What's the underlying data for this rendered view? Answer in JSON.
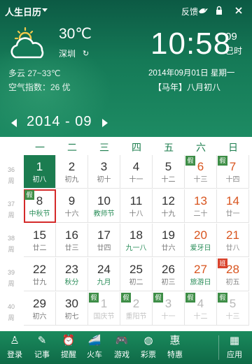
{
  "app": {
    "title": "人生日历",
    "feedback": "反馈"
  },
  "weather": {
    "temperature": "30℃",
    "city": "深圳",
    "refresh_icon": "↻",
    "desc": "多云  27~33℃",
    "aqi": "空气指数：26 优"
  },
  "clock": {
    "time": "10:58",
    "seconds": "09",
    "ampm": "巳时"
  },
  "date": {
    "gregorian": "2014年09月01日  星期一",
    "lunar": "【马年】八月初八"
  },
  "nav": {
    "month": "2014 - 09"
  },
  "weekdays": [
    "一",
    "二",
    "三",
    "四",
    "五",
    "六",
    "日"
  ],
  "weeks": [
    {
      "num": "36",
      "label": "周",
      "days": [
        {
          "d": "1",
          "l": "初八",
          "state": "today"
        },
        {
          "d": "2",
          "l": "初九"
        },
        {
          "d": "3",
          "l": "初十"
        },
        {
          "d": "4",
          "l": "十一"
        },
        {
          "d": "5",
          "l": "十二"
        },
        {
          "d": "6",
          "l": "十三",
          "weekend": true,
          "badge": "假"
        },
        {
          "d": "7",
          "l": "十四",
          "weekend": true,
          "badge": "假"
        }
      ]
    },
    {
      "num": "37",
      "label": "周",
      "days": [
        {
          "d": "8",
          "l": "中秋节",
          "fest": true,
          "badge": "假",
          "state": "selected"
        },
        {
          "d": "9",
          "l": "十六"
        },
        {
          "d": "10",
          "l": "教师节",
          "fest": true
        },
        {
          "d": "11",
          "l": "十八"
        },
        {
          "d": "12",
          "l": "十九"
        },
        {
          "d": "13",
          "l": "二十",
          "weekend": true
        },
        {
          "d": "14",
          "l": "廿一",
          "weekend": true
        }
      ]
    },
    {
      "num": "38",
      "label": "周",
      "days": [
        {
          "d": "15",
          "l": "廿二"
        },
        {
          "d": "16",
          "l": "廿三"
        },
        {
          "d": "17",
          "l": "廿四"
        },
        {
          "d": "18",
          "l": "九一八",
          "fest": true
        },
        {
          "d": "19",
          "l": "廿六"
        },
        {
          "d": "20",
          "l": "爱牙日",
          "weekend": true,
          "fest": true
        },
        {
          "d": "21",
          "l": "廿八",
          "weekend": true
        }
      ]
    },
    {
      "num": "39",
      "label": "周",
      "days": [
        {
          "d": "22",
          "l": "廿九"
        },
        {
          "d": "23",
          "l": "秋分",
          "fest": true
        },
        {
          "d": "24",
          "l": "九月",
          "fest": true
        },
        {
          "d": "25",
          "l": "初二"
        },
        {
          "d": "26",
          "l": "初三"
        },
        {
          "d": "27",
          "l": "旅游日",
          "weekend": true,
          "fest": true
        },
        {
          "d": "28",
          "l": "初五",
          "weekend": true,
          "badge": "班",
          "badge_red": true
        }
      ]
    },
    {
      "num": "40",
      "label": "周",
      "days": [
        {
          "d": "29",
          "l": "初六"
        },
        {
          "d": "30",
          "l": "初七"
        },
        {
          "d": "1",
          "l": "国庆节",
          "faded": true,
          "badge": "假"
        },
        {
          "d": "2",
          "l": "重阳节",
          "faded": true,
          "badge": "假"
        },
        {
          "d": "3",
          "l": "十一",
          "faded": true,
          "badge": "假"
        },
        {
          "d": "4",
          "l": "十二",
          "faded": true,
          "badge": "假"
        },
        {
          "d": "5",
          "l": "十三",
          "faded": true,
          "badge": "假"
        }
      ]
    }
  ],
  "toolbar": [
    {
      "label": "登录",
      "icon": "person-icon",
      "glyph": "♙"
    },
    {
      "label": "记事",
      "icon": "note-icon",
      "glyph": "✎"
    },
    {
      "label": "提醒",
      "icon": "alarm-clock-icon",
      "glyph": "⏰"
    },
    {
      "label": "火车",
      "icon": "train-icon",
      "glyph": "🚄"
    },
    {
      "label": "游戏",
      "icon": "gamepad-icon",
      "glyph": "🎮"
    },
    {
      "label": "彩票",
      "icon": "lottery-ball-icon",
      "glyph": "◍"
    },
    {
      "label": "特惠",
      "icon": "discount-icon",
      "glyph": "惠"
    },
    {
      "label": "应用",
      "icon": "apps-grid-icon",
      "glyph": "▦"
    }
  ],
  "colors": {
    "header": "#157a57",
    "today": "#1b7c50",
    "weekend": "#d8541e",
    "selected_border": "#d42a2a",
    "holiday_badge": "#3e8e47",
    "workday_badge": "#d9442e"
  }
}
